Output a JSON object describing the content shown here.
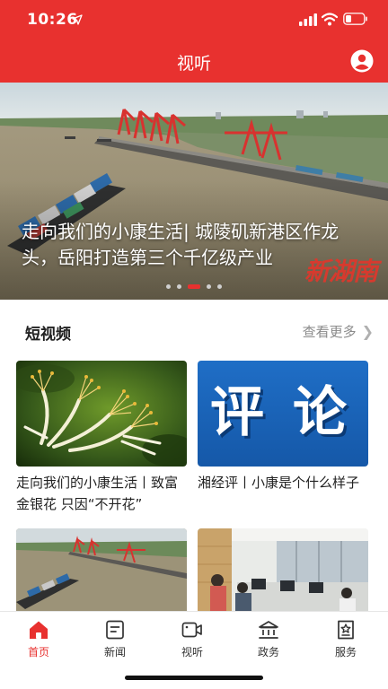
{
  "status_bar": {
    "time": "10:26"
  },
  "header": {
    "title": "视听"
  },
  "hero": {
    "caption": "走向我们的小康生活| 城陵矶新港区作龙头，岳阳打造第三个千亿级产业",
    "watermark": "新湖南",
    "slide_count": 5,
    "active_slide": 3
  },
  "section": {
    "title": "短视频",
    "more_label": "查看更多"
  },
  "videos": [
    {
      "title": "走向我们的小康生活丨致富金银花 只因“不开花”"
    },
    {
      "title": "湘经评丨小康是个什么样子",
      "thumb_text_1": "评",
      "thumb_text_2": "论"
    },
    {
      "title": ""
    },
    {
      "title": ""
    }
  ],
  "tabbar": {
    "items": [
      {
        "label": "首页",
        "icon": "home-icon",
        "active": true
      },
      {
        "label": "新闻",
        "icon": "news-icon",
        "active": false
      },
      {
        "label": "视听",
        "icon": "video-icon",
        "active": false
      },
      {
        "label": "政务",
        "icon": "government-icon",
        "active": false
      },
      {
        "label": "服务",
        "icon": "service-icon",
        "active": false
      }
    ]
  },
  "colors": {
    "brand_red": "#e8312f",
    "muted_text": "#8a8a8a"
  }
}
